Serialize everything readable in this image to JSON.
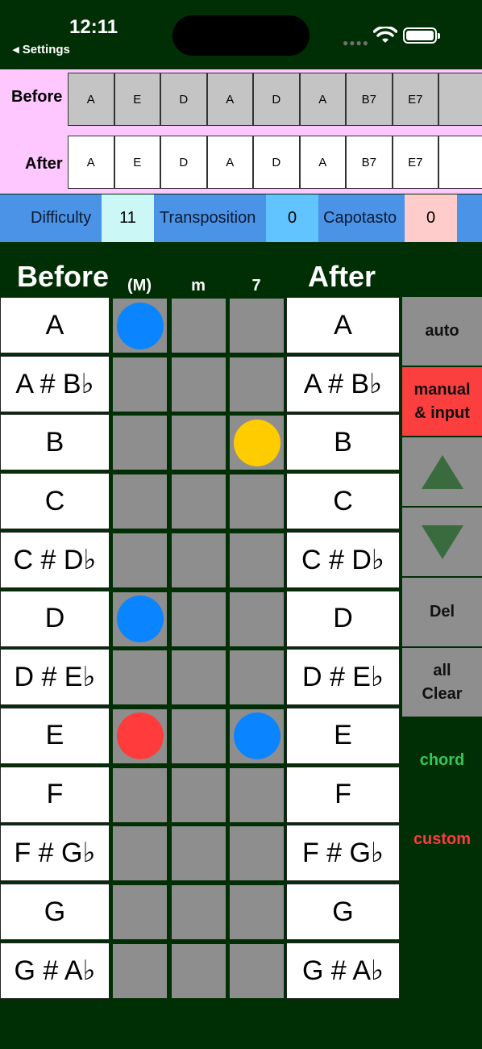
{
  "status_bar": {
    "time": "12:11",
    "back_label": "◂ Settings"
  },
  "sequence": {
    "before_label": "Before",
    "after_label": "After",
    "before": [
      "A",
      "E",
      "D",
      "A",
      "D",
      "A",
      "B7",
      "E7",
      ""
    ],
    "after": [
      "A",
      "E",
      "D",
      "A",
      "D",
      "A",
      "B7",
      "E7",
      ""
    ]
  },
  "info": {
    "difficulty_label": "Difficulty",
    "difficulty_value": "11",
    "transposition_label": "Transposition",
    "transposition_value": "0",
    "capotasto_label": "Capotasto",
    "capotasto_value": "0"
  },
  "grid": {
    "before_title": "Before",
    "after_title": "After",
    "columns": [
      "(M)",
      "m",
      "7"
    ],
    "notes": [
      "A",
      "A # B♭",
      "B",
      "C",
      "C # D♭",
      "D",
      "D # E♭",
      "E",
      "F",
      "F # G♭",
      "G",
      "G # A♭"
    ],
    "markers": [
      {
        "row": 0,
        "col": 0,
        "color": "#0a84ff"
      },
      {
        "row": 2,
        "col": 2,
        "color": "#ffcc00"
      },
      {
        "row": 5,
        "col": 0,
        "color": "#0a84ff"
      },
      {
        "row": 7,
        "col": 0,
        "color": "#ff3b3b"
      },
      {
        "row": 7,
        "col": 2,
        "color": "#0a84ff"
      }
    ]
  },
  "side_buttons": {
    "auto": "auto",
    "manual": "manual & input",
    "del": "Del",
    "all_clear": "all Clear",
    "chord": "chord",
    "custom": "custom"
  },
  "colors": {
    "background": "#012f05",
    "pink_strip": "#ffc7ff",
    "info_bar": "#4a93e6",
    "chord_text": "#34c759",
    "custom_text": "#ff3b3b",
    "arrow": "#3a6b3e"
  }
}
